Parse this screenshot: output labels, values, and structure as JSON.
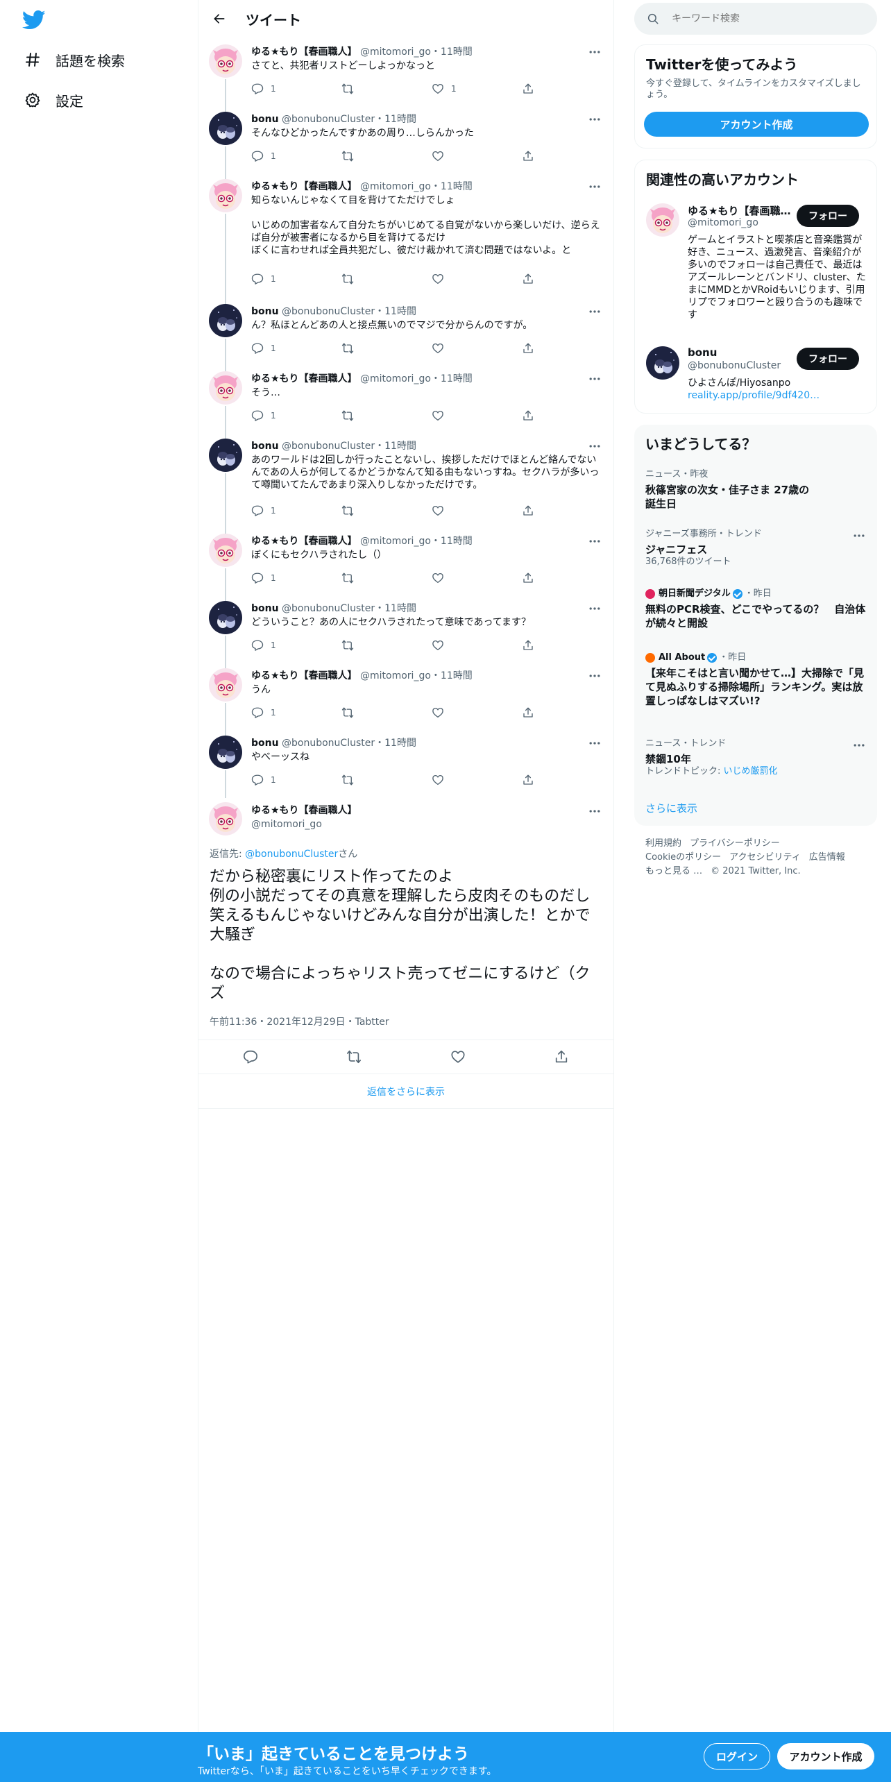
{
  "nav": {
    "explore_label": "話題を検索",
    "settings_label": "設定"
  },
  "header": {
    "title": "ツイート"
  },
  "thread": [
    {
      "author": "yuru",
      "name": "ゆる★もり【春画職人】",
      "handle": "@mitomori_go",
      "time": "11時間",
      "text": "さてと、共犯者リストどーしよっかなっと",
      "replies": "1",
      "retweets": "",
      "likes": "1"
    },
    {
      "author": "bonu",
      "name": "bonu",
      "handle": "@bonubonuCluster",
      "time": "11時間",
      "text": "そんなひどかったんですかあの周り…しらんかった",
      "replies": "1",
      "retweets": "",
      "likes": ""
    },
    {
      "author": "yuru",
      "name": "ゆる★もり【春画職人】",
      "handle": "@mitomori_go",
      "time": "11時間",
      "text": "知らないんじゃなくて目を背けてただけでしょ\n\nいじめの加害者なんて自分たちがいじめてる自覚がないから楽しいだけ、逆らえば自分が被害者になるから目を背けてるだけ\nぼくに言わせれば全員共犯だし、彼だけ裁かれて済む問題ではないよ。と",
      "replies": "1",
      "retweets": "",
      "likes": ""
    },
    {
      "author": "bonu",
      "name": "bonu",
      "handle": "@bonubonuCluster",
      "time": "11時間",
      "text": "ん？私ほとんどあの人と接点無いのでマジで分からんのですが。",
      "replies": "1",
      "retweets": "",
      "likes": ""
    },
    {
      "author": "yuru",
      "name": "ゆる★もり【春画職人】",
      "handle": "@mitomori_go",
      "time": "11時間",
      "text": "そう…",
      "replies": "1",
      "retweets": "",
      "likes": ""
    },
    {
      "author": "bonu",
      "name": "bonu",
      "handle": "@bonubonuCluster",
      "time": "11時間",
      "text": "あのワールドは2回しか行ったことないし、挨拶しただけでほとんど絡んでないんであの人らが何してるかどうかなんて知る由もないっすね。セクハラが多いって噂聞いてたんであまり深入りしなかっただけです。",
      "replies": "1",
      "retweets": "",
      "likes": ""
    },
    {
      "author": "yuru",
      "name": "ゆる★もり【春画職人】",
      "handle": "@mitomori_go",
      "time": "11時間",
      "text": "ぼくにもセクハラされたし（）",
      "replies": "1",
      "retweets": "",
      "likes": ""
    },
    {
      "author": "bonu",
      "name": "bonu",
      "handle": "@bonubonuCluster",
      "time": "11時間",
      "text": "どういうこと？あの人にセクハラされたって意味であってます？",
      "replies": "1",
      "retweets": "",
      "likes": ""
    },
    {
      "author": "yuru",
      "name": "ゆる★もり【春画職人】",
      "handle": "@mitomori_go",
      "time": "11時間",
      "text": "うん",
      "replies": "1",
      "retweets": "",
      "likes": ""
    },
    {
      "author": "bonu",
      "name": "bonu",
      "handle": "@bonubonuCluster",
      "time": "11時間",
      "text": "やべーッスね",
      "replies": "1",
      "retweets": "",
      "likes": ""
    }
  ],
  "focus": {
    "name": "ゆる★もり【春画職人】",
    "handle": "@mitomori_go",
    "reply_prefix": "返信先: ",
    "reply_to": "@bonubonuCluster",
    "reply_suffix": "さん",
    "text": "だから秘密裏にリスト作ってたのよ\n例の小説だってその真意を理解したら皮肉そのものだし笑えるもんじゃないけどみんな自分が出演した！とかで大騒ぎ\n\nなので場合によっちゃリスト売ってゼニにするけど（クズ",
    "meta": "午前11:36・2021年12月29日・Tabtter",
    "show_more": "返信をさらに表示"
  },
  "sidebar": {
    "search_placeholder": "キーワード検索",
    "signup_card": {
      "title": "Twitterを使ってみよう",
      "subtitle": "今すぐ登録して、タイムラインをカスタマイズしましょう。",
      "button": "アカウント作成"
    },
    "related": {
      "title": "関連性の高いアカウント",
      "follow_label": "フォロー",
      "accounts": [
        {
          "name": "ゆる★もり【春画職人】",
          "handle": "@mitomori_go",
          "bio": "ゲームとイラストと喫茶店と音楽鑑賞が好き、ニュース、過激発言、音楽紹介が多いのでフォローは自己責任で、最近はアズールレーンとバンドリ、cluster、たまにMMDとかVRoidもいじります、引用リプでフォロワーと殴り合うのも趣味です",
          "link": ""
        },
        {
          "name": "bonu",
          "handle": "@bonubonuCluster",
          "bio": "ひよさんぽ/Hiyosanpo",
          "link": "reality.app/profile/9df420…"
        }
      ]
    },
    "trends": {
      "title": "いまどうしてる？",
      "items": [
        {
          "meta": "ニュース・昨夜",
          "title": "秋篠宮家の次女・佳子さま 27歳の\n誕生日",
          "count": ""
        },
        {
          "meta": "ジャニーズ事務所・トレンド",
          "title": "ジャニフェス",
          "count": "36,768件のツイート"
        },
        {
          "source": "朝日新聞デジタル",
          "when": "・昨日",
          "title": "無料のPCR検査、どこでやってるの？　自治体が続々と開設",
          "count": ""
        },
        {
          "source": "All About",
          "when": "・昨日",
          "title": "【来年こそはと言い聞かせて…】大掃除で「見て見ぬふりする掃除場所」ランキング。実は放置しっぱなしはマズい!?",
          "count": ""
        },
        {
          "meta": "ニュース・トレンド",
          "title": "禁錮10年",
          "count_prefix": "トレンドトピック: ",
          "count_link": "いじめ厳罰化"
        }
      ],
      "show_more": "さらに表示"
    },
    "footer": {
      "links": [
        "利用規約",
        "プライバシーポリシー",
        "Cookieのポリシー",
        "アクセシビリティ",
        "広告情報",
        "もっと見る …"
      ],
      "copyright": "© 2021 Twitter, Inc."
    }
  },
  "bottom_bar": {
    "title": "「いま」起きていることを見つけよう",
    "subtitle": "Twitterなら、「いま」起きていることをいち早くチェックできます。",
    "login": "ログイン",
    "signup": "アカウント作成"
  },
  "colors": {
    "accent": "#1d9bf0",
    "text": "#0f1419",
    "muted": "#536471",
    "border": "#eff3f4"
  }
}
